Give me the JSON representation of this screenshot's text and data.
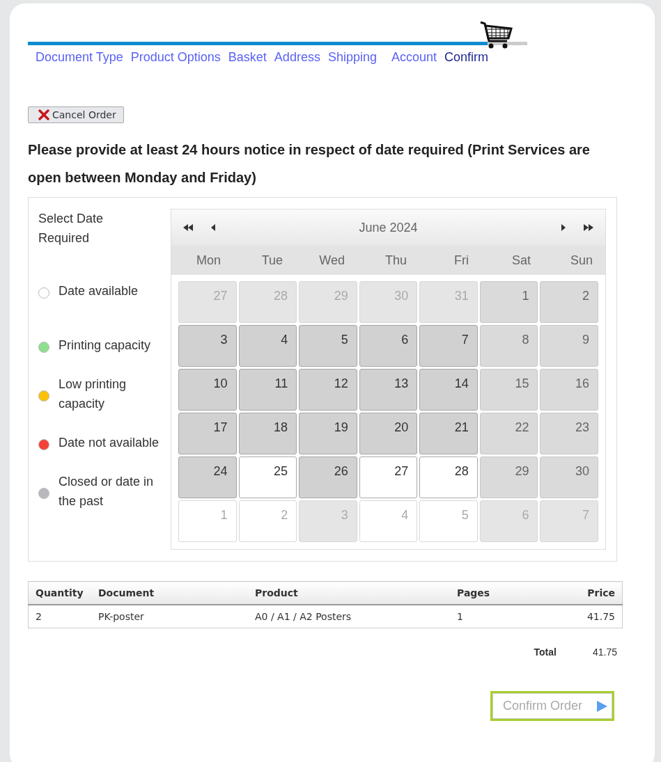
{
  "progress": {
    "level": 0.92
  },
  "steps": [
    {
      "label": "Document Type",
      "selected": false
    },
    {
      "label": "Product Options",
      "selected": false
    },
    {
      "label": "Basket",
      "selected": false
    },
    {
      "label": "Address",
      "selected": false
    },
    {
      "label": "Shipping",
      "selected": false
    },
    {
      "label": "Account",
      "selected": false
    },
    {
      "label": "Confirm",
      "selected": true
    }
  ],
  "cancel_button": "Cancel Order",
  "notice": "Please provide at least 24 hours notice in respect of date required (Print Services are open between Monday and Friday)",
  "date_picker": {
    "heading": "Select Date Required",
    "legend": [
      {
        "label": "Date available",
        "color": "#ffffff"
      },
      {
        "label": "Printing capacity",
        "color": "#8ee08e"
      },
      {
        "label": "Low printing capacity",
        "color": "#ffc107"
      },
      {
        "label": "Date not available",
        "color": "#f44336"
      },
      {
        "label": "Closed or date in the past",
        "color": "#b9b9bd"
      }
    ],
    "month": "June 2024",
    "weekdays": [
      "Mon",
      "Tue",
      "Wed",
      "Thu",
      "Fri",
      "Sat",
      "Sun"
    ],
    "days": [
      {
        "day": "27",
        "kind": "closed",
        "outside": true
      },
      {
        "day": "28",
        "kind": "closed",
        "outside": true
      },
      {
        "day": "29",
        "kind": "closed",
        "outside": true
      },
      {
        "day": "30",
        "kind": "closed",
        "outside": true
      },
      {
        "day": "31",
        "kind": "closed",
        "outside": true
      },
      {
        "day": "1",
        "kind": "weekend",
        "outside": false
      },
      {
        "day": "2",
        "kind": "weekend",
        "outside": false
      },
      {
        "day": "3",
        "kind": "past",
        "outside": false
      },
      {
        "day": "4",
        "kind": "past",
        "outside": false
      },
      {
        "day": "5",
        "kind": "past",
        "outside": false
      },
      {
        "day": "6",
        "kind": "past",
        "outside": false
      },
      {
        "day": "7",
        "kind": "past",
        "outside": false
      },
      {
        "day": "8",
        "kind": "weekend",
        "outside": false
      },
      {
        "day": "9",
        "kind": "weekend",
        "outside": false
      },
      {
        "day": "10",
        "kind": "past",
        "outside": false
      },
      {
        "day": "11",
        "kind": "past",
        "outside": false
      },
      {
        "day": "12",
        "kind": "past",
        "outside": false
      },
      {
        "day": "13",
        "kind": "past",
        "outside": false
      },
      {
        "day": "14",
        "kind": "past",
        "outside": false
      },
      {
        "day": "15",
        "kind": "weekend",
        "outside": false
      },
      {
        "day": "16",
        "kind": "weekend",
        "outside": false
      },
      {
        "day": "17",
        "kind": "past",
        "outside": false
      },
      {
        "day": "18",
        "kind": "past",
        "outside": false
      },
      {
        "day": "19",
        "kind": "past",
        "outside": false
      },
      {
        "day": "20",
        "kind": "past",
        "outside": false
      },
      {
        "day": "21",
        "kind": "past",
        "outside": false
      },
      {
        "day": "22",
        "kind": "weekend",
        "outside": false
      },
      {
        "day": "23",
        "kind": "weekend",
        "outside": false
      },
      {
        "day": "24",
        "kind": "past",
        "outside": false
      },
      {
        "day": "25",
        "kind": "available",
        "outside": false
      },
      {
        "day": "26",
        "kind": "past",
        "outside": false
      },
      {
        "day": "27",
        "kind": "available",
        "outside": false
      },
      {
        "day": "28",
        "kind": "available",
        "outside": false
      },
      {
        "day": "29",
        "kind": "weekend",
        "outside": false
      },
      {
        "day": "30",
        "kind": "weekend",
        "outside": false
      },
      {
        "day": "1",
        "kind": "available",
        "outside": true
      },
      {
        "day": "2",
        "kind": "available",
        "outside": true
      },
      {
        "day": "3",
        "kind": "closed",
        "outside": true
      },
      {
        "day": "4",
        "kind": "available",
        "outside": true
      },
      {
        "day": "5",
        "kind": "available",
        "outside": true
      },
      {
        "day": "6",
        "kind": "closed",
        "outside": true
      },
      {
        "day": "7",
        "kind": "closed",
        "outside": true
      }
    ]
  },
  "order_table": {
    "columns": [
      "Quantity",
      "Document",
      "Product",
      "Pages",
      "Price"
    ],
    "rows": [
      [
        "2",
        "PK-poster",
        "A0 / A1 / A2 Posters",
        "1",
        "41.75"
      ]
    ]
  },
  "total": {
    "label": "Total",
    "value": "41.75"
  },
  "confirm_button": {
    "label": "Confirm Order",
    "disabled": true
  }
}
